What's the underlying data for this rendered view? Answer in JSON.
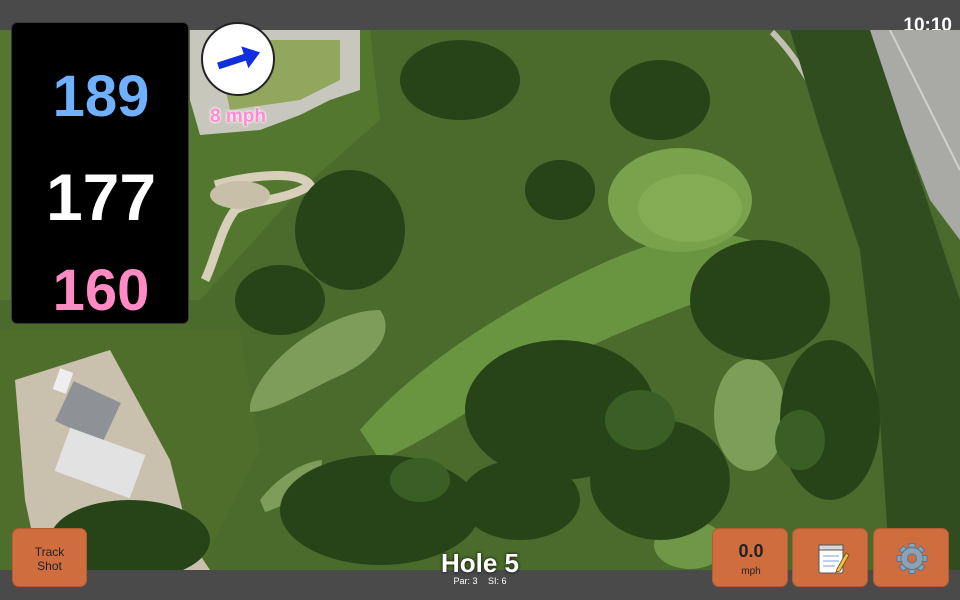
{
  "status_bar": {
    "time": "10:10"
  },
  "yardage": {
    "back": "189",
    "middle": "177",
    "front": "160"
  },
  "wind": {
    "speed_label": "8 mph",
    "direction_icon": "arrow-right-icon"
  },
  "hole": {
    "title": "Hole 5",
    "par_label": "Par: 3",
    "si_label": "SI: 6"
  },
  "buttons": {
    "track_shot": {
      "line1": "Track",
      "line2": "Shot"
    },
    "speed": {
      "value": "0.0",
      "unit": "mph"
    },
    "notes_icon": "notepad-icon",
    "settings_icon": "gear-icon"
  },
  "colors": {
    "back_yardage": "#6fb0ff",
    "middle_yardage": "#ffffff",
    "front_yardage": "#ff8ac4",
    "button": "#cf6d3f",
    "wind_arrow": "#1030e0"
  }
}
